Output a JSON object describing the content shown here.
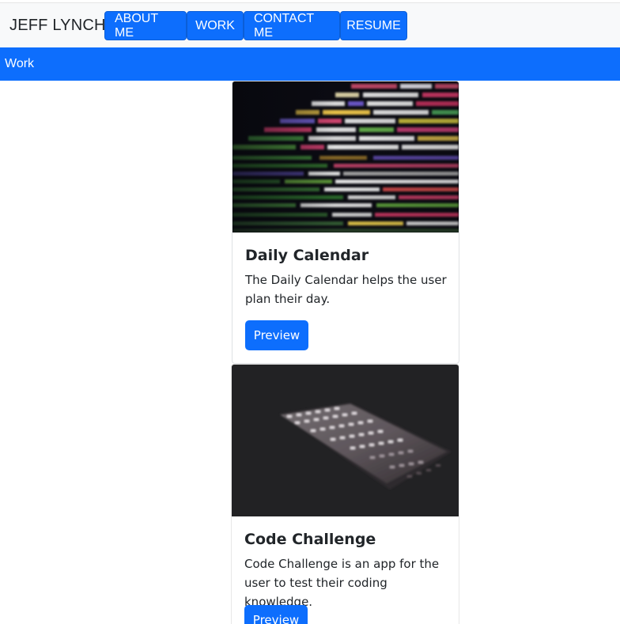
{
  "navbar": {
    "brand": "JEFF LYNCH",
    "buttons": [
      "ABOUT ME",
      "WORK",
      "CONTACT ME",
      "RESUME"
    ]
  },
  "section": {
    "title": "Work"
  },
  "cards": [
    {
      "title": "Daily Calendar",
      "text": "The Daily Calendar helps the user plan their day.",
      "button": "Preview",
      "image": "code-screen-image"
    },
    {
      "title": "Code Challenge",
      "text": "Code Challenge is an app for the user to test their coding knowledge.",
      "button": "Preview",
      "image": "backlit-keyboard-image"
    }
  ],
  "colors": {
    "primary": "#0d6efd",
    "navbar_bg": "#f8f9fa"
  }
}
